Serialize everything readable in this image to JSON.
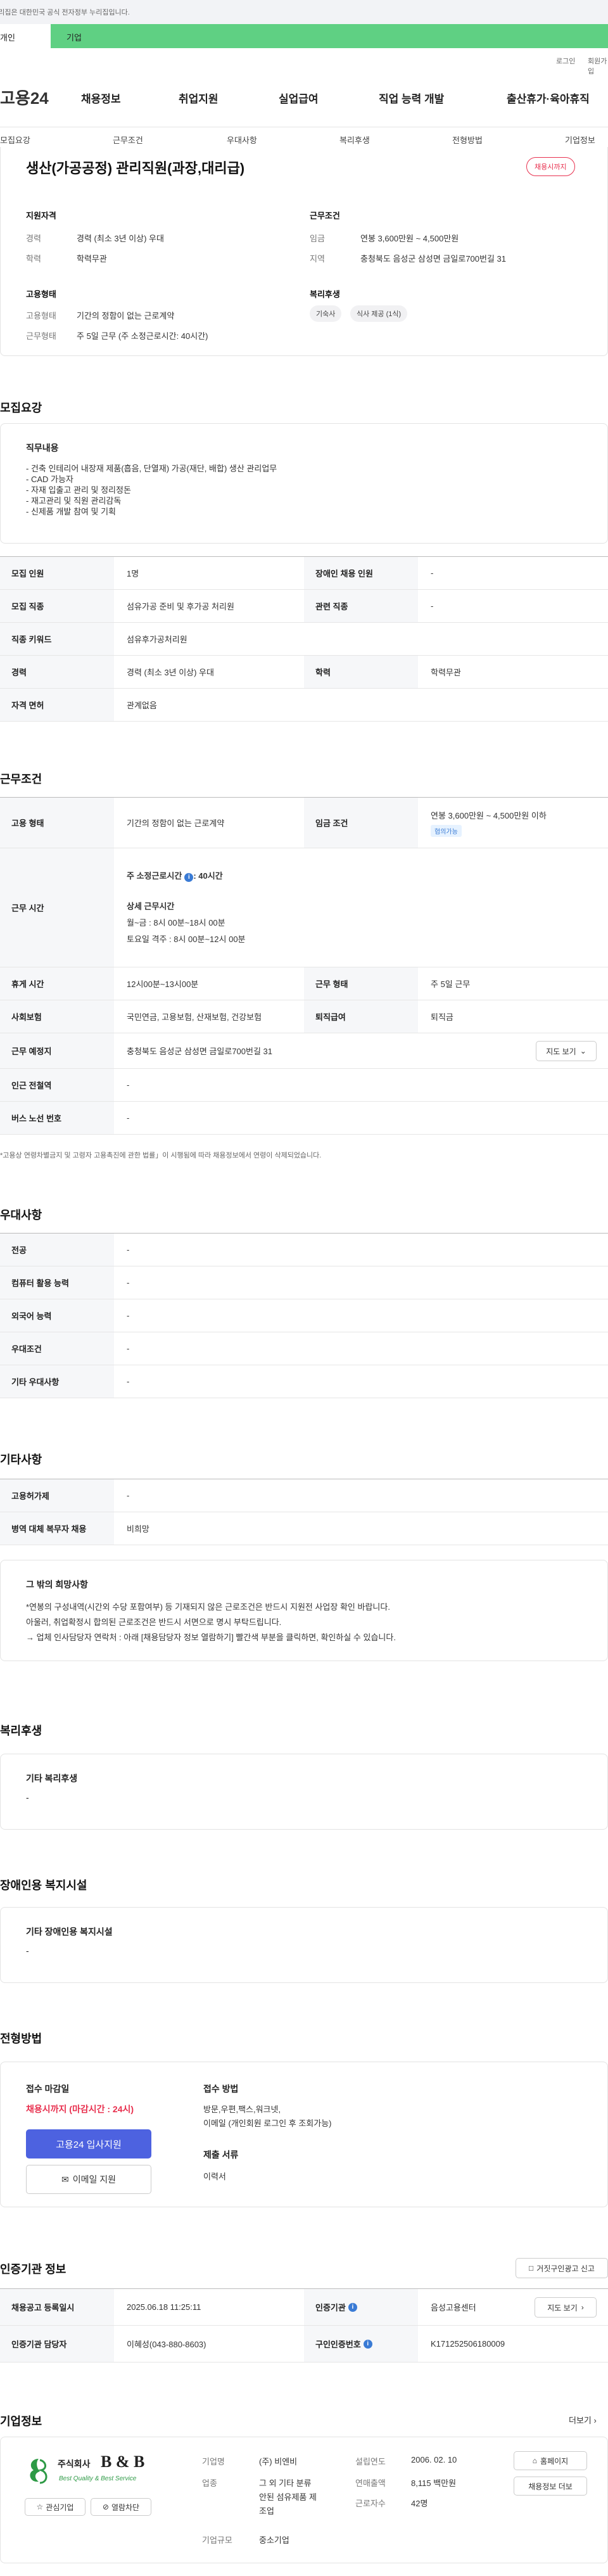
{
  "notice": {
    "text": "이 누리집은 대한민국 공식 전자정부 누리집입니다."
  },
  "top_tabs": {
    "personal": "개인",
    "company": "기업"
  },
  "util": {
    "login": "로그인",
    "join": "회원가입"
  },
  "logo": {
    "text": "고용24"
  },
  "gnb": [
    "채용정보",
    "취업지원",
    "실업급여",
    "직업 능력 개발",
    "출산휴가·육아휴직"
  ],
  "subnav": [
    "모집요강",
    "근무조건",
    "우대사항",
    "복리후생",
    "전형방법",
    "기업정보"
  ],
  "summary": {
    "title": "생산(가공공정) 관리직원(과장,대리급)",
    "badge": "채용시까지",
    "qual_title": "지원자격",
    "career_label": "경력",
    "career_value": "경력 (최소 3년 이상) 우대",
    "edu_label": "학력",
    "edu_value": "학력무관",
    "cond_title": "근무조건",
    "wage_label": "임금",
    "wage_value": "연봉 3,600만원 ~ 4,500만원",
    "region_label": "지역",
    "region_value": "충청북도 음성군 삼성면 금일로700번길 31",
    "emp_title": "고용형태",
    "emp_type_label": "고용형태",
    "emp_type_value": "기간의 정함이 없는 근로계약",
    "work_label": "근무형태",
    "work_value": "주 5일 근무 (주 소정근로시간: 40시간)",
    "welfare_title": "복리후생",
    "welfare_chips": [
      "기숙사",
      "식사 제공 (1식)"
    ]
  },
  "recruit": {
    "heading": "모집요강",
    "duty_title": "직무내용",
    "duty_lines": [
      "- 건축 인테리어 내장재 제품(흡음, 단열재) 가공(재단, 배합) 생산  관리업무",
      "- CAD 가능자",
      "- 자재 입출고 관리 및 정리정돈",
      "- 재고관리 및  직원 관리감독",
      "- 신제품 개발 참여 및 기획"
    ],
    "rows": [
      {
        "l1": "모집 인원",
        "v1": "1명",
        "l2": "장애인 채용 인원",
        "v2": "-"
      },
      {
        "l1": "모집 직종",
        "v1": "섬유가공 준비 및 후가공 처리원",
        "l2": "관련 직종",
        "v2": "-"
      },
      {
        "l1": "직종 키워드",
        "v1": "섬유후가공처리원",
        "l2": "",
        "v2": ""
      },
      {
        "l1": "경력",
        "v1": "경력 (최소 3년 이상) 우대",
        "l2": "학력",
        "v2": "학력무관"
      },
      {
        "l1": "자격 면허",
        "v1": "관계없음",
        "l2": "",
        "v2": ""
      }
    ]
  },
  "conditions": {
    "heading": "근무조건",
    "emp_label": "고용 형태",
    "emp_value": "기간의 정함이 없는 근로계약",
    "wage_label": "임금 조건",
    "wage_value": "연봉 3,600만원 ~ 4,500만원 이하",
    "wage_tag": "협의가능",
    "time_label": "근무 시간",
    "time_main": "주 소정근로시간",
    "time_hours": ": 40시간",
    "time_detail_title": "상세 근무시간",
    "time_weekday": "월~금 : 8시 00분~18시 00분",
    "time_sat": "토요일 격주 : 8시 00분~12시 00분",
    "break_label": "휴게 시간",
    "break_value": "12시00분~13시00분",
    "type_label": "근무 형태",
    "type_value": "주 5일 근무",
    "ins_label": "사회보험",
    "ins_value": "국민연금, 고용보험, 산재보험, 건강보험",
    "sev_label": "퇴직급여",
    "sev_value": "퇴직금",
    "place_label": "근무 예정지",
    "place_value": "충청북도 음성군 삼성면 금일로700번길 31",
    "map_btn": "지도 보기",
    "subway_label": "인근 전철역",
    "subway_value": "-",
    "bus_label": "버스 노선 번호",
    "bus_value": "-",
    "footnote": "*고용상 연령차별금지 및 고령자 고용촉진에 관한 법률」이 시행됨에 따라 채용정보에서 연령이 삭제되었습니다."
  },
  "pref": {
    "heading": "우대사항",
    "rows": [
      {
        "l": "전공",
        "v": "-"
      },
      {
        "l": "컴퓨터 활용 능력",
        "v": "-"
      },
      {
        "l": "외국어 능력",
        "v": "-"
      },
      {
        "l": "우대조건",
        "v": "-"
      },
      {
        "l": "기타 우대사항",
        "v": "-"
      }
    ]
  },
  "etc": {
    "heading": "기타사항",
    "rows": [
      {
        "l": "고용허가제",
        "v": "-"
      },
      {
        "l": "병역 대체 복무자 채용",
        "v": "비희망"
      }
    ],
    "box_title": "그 밖의 희망사항",
    "box_lines": [
      "*연봉의 구성내역(시간외 수당 포함여부) 등 기재되지 않은 근로조건은 반드시 지원전 사업장 확인 바랍니다.",
      "아울러, 취업확정시 합의된 근로조건은 반드시 서면으로 명시 부탁드립니다.",
      "→ 업체 인사담당자 연락처 : 아래 [채용담당자 정보 열람하기] 빨간색 부분을 클릭하면, 확인하실 수 있습니다."
    ]
  },
  "welfare": {
    "heading": "복리후생",
    "box_title": "기타 복리후생",
    "box_value": "-"
  },
  "disabled": {
    "heading": "장애인용 복지시설",
    "box_title": "기타 장애인용 복지시설",
    "box_value": "-"
  },
  "apply": {
    "heading": "전형방법",
    "deadline_title": "접수 마감일",
    "deadline_value": "채용시까지 (마감시간 : 24시)",
    "apply_btn": "고용24 입사지원",
    "email_btn": "이메일 지원",
    "method_title": "접수 방법",
    "method_line1": "방문,우편,팩스,워크넷,",
    "method_line2": "이메일 (개인회원 로그인 후 조회가능)",
    "docs_title": "제출 서류",
    "docs_value": "이력서"
  },
  "cert": {
    "heading": "인증기관 정보",
    "report_btn": "거짓구인광고 신고",
    "reg_label": "채용공고 등록일시",
    "reg_value": "2025.06.18 11:25:11",
    "org_label": "인증기관",
    "org_value": "음성고용센터",
    "map_btn": "지도 보기",
    "mgr_label": "인증기관 담당자",
    "mgr_value": "이혜성(043-880-8603)",
    "num_label": "구인인증번호",
    "num_value": "K171252506180009"
  },
  "company": {
    "heading": "기업정보",
    "more": "더보기",
    "logo_name": "주식회사",
    "logo_mark": "B & B",
    "logo_sub": "Best Quality & Best Service",
    "fav_btn": "관심기업",
    "block_btn": "열람차단",
    "name_label": "기업명",
    "name_value": "(주) 비엔비",
    "ind_label": "업종",
    "ind_value1": "그 외 기타 분류",
    "ind_value2": "안된 섬유제품 제",
    "ind_value3": "조업",
    "size_label": "기업규모",
    "size_value": "중소기업",
    "est_label": "설립연도",
    "est_value": "2006. 02. 10",
    "sales_label": "연매출액",
    "sales_value": "8,115 백만원",
    "emp_label": "근로자수",
    "emp_value": "42명",
    "home_btn": "홈페이지",
    "info_btn": "채용정보 더보"
  }
}
